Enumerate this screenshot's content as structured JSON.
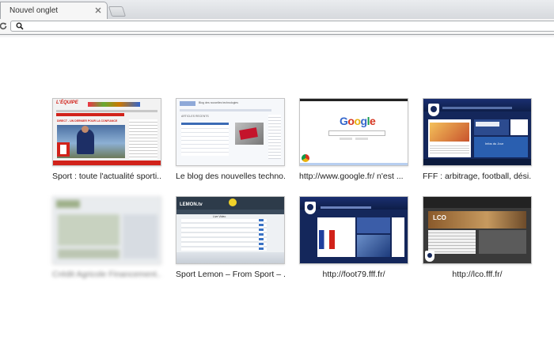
{
  "tab": {
    "title": "Nouvel onglet"
  },
  "omnibox": {
    "value": ""
  },
  "tiles": [
    {
      "label": "Sport : toute l'actualité sporti...",
      "thumb": {
        "logo": "L'ÉQUIPE",
        "headline": "DIRECT - UN DERNIER POUR LA CONFIANCE"
      }
    },
    {
      "label": "Le blog des nouvelles techno...",
      "thumb": {
        "site": "Blog des nouvelles technologies",
        "section": "ARTICLES RECENTS"
      }
    },
    {
      "label": "http://www.google.fr/ n'est ...",
      "thumb": {
        "logo_letters": [
          "G",
          "o",
          "o",
          "g",
          "l",
          "e"
        ]
      }
    },
    {
      "label": "FFF : arbitrage, football, dési...",
      "thumb": {
        "section": "Infos du Jour"
      }
    },
    {
      "label": "Crédit Agricole Financement...",
      "thumb": {}
    },
    {
      "label": "Sport Lemon – From Sport – ...",
      "thumb": {
        "logo": "LEMON.tv",
        "section": "Live Video"
      }
    },
    {
      "label": "http://foot79.fff.fr/",
      "thumb": {}
    },
    {
      "label": "http://lco.fff.fr/",
      "thumb": {
        "logo": "LCO"
      }
    }
  ],
  "colors": {
    "google_blue": "#3366cc",
    "google_red": "#d5351f",
    "google_yellow": "#e8b10d",
    "google_green": "#139a4a",
    "fff_navy": "#14275b",
    "equipe_red": "#d1221a",
    "lemon_dark": "#2d3b4a"
  },
  "icons": {
    "tab_close": "close-icon",
    "reload": "reload-icon",
    "omnibox": "search-icon",
    "new_tab": "new-tab-icon"
  }
}
